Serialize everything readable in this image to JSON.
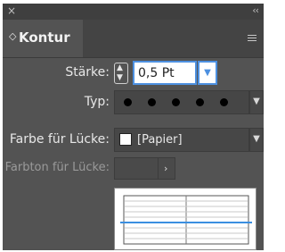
{
  "titlebar": {
    "close_glyph": "×",
    "collapse_glyph": "‹‹"
  },
  "tab": {
    "title": "Kontur",
    "chevron_glyph": "◇"
  },
  "fields": {
    "staerke": {
      "label": "Stärke:",
      "value": "0,5 Pt"
    },
    "typ": {
      "label": "Typ:",
      "pattern": "dotted"
    },
    "farbe": {
      "label": "Farbe für Lücke:",
      "value": "[Papier]"
    },
    "farbton": {
      "label": "Farbton für Lücke:",
      "value": ""
    }
  },
  "icons": {
    "close": "close-icon",
    "collapse": "collapse-icon",
    "menu": "panel-menu-icon",
    "stepper": "stepper-icon",
    "dropdown": "chevron-down-icon",
    "next": "chevron-right-icon"
  },
  "colors": {
    "panel_bg": "#535353",
    "focus_border": "#4d90e0",
    "preview_stroke": "#3b8fe0"
  }
}
